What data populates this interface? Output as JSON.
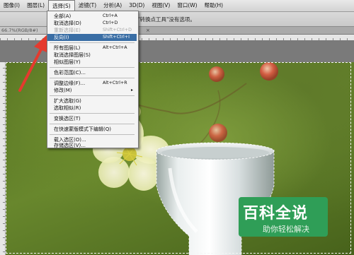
{
  "menubar": {
    "items": [
      {
        "label": "图像(I)"
      },
      {
        "label": "图层(L)"
      },
      {
        "label": "选择(S)"
      },
      {
        "label": "滤镜(T)"
      },
      {
        "label": "分析(A)"
      },
      {
        "label": "3D(D)"
      },
      {
        "label": "视图(V)"
      },
      {
        "label": "窗口(W)"
      },
      {
        "label": "帮助(H)"
      }
    ]
  },
  "options": {
    "hint": "\"转换点工具\"没有选项。"
  },
  "document": {
    "tab_label": "66.7%(RGB/8#)",
    "close_label": "×"
  },
  "select_menu": {
    "items": [
      {
        "label": "全部(A)",
        "shortcut": "Ctrl+A"
      },
      {
        "label": "取消选择(D)",
        "shortcut": "Ctrl+D"
      },
      {
        "label": "重新选择(E)",
        "shortcut": "Shift+Ctrl+D"
      },
      {
        "label": "反向(I)",
        "shortcut": "Shift+Ctrl+I"
      },
      {
        "label": "所有图层(L)",
        "shortcut": "Alt+Ctrl+A"
      },
      {
        "label": "取消选择图层(S)",
        "shortcut": ""
      },
      {
        "label": "相似图层(Y)",
        "shortcut": ""
      },
      {
        "label": "色彩范围(C)...",
        "shortcut": ""
      },
      {
        "label": "调整边缘(F)...",
        "shortcut": "Alt+Ctrl+R"
      },
      {
        "label": "修改(M)",
        "shortcut": ""
      },
      {
        "label": "扩大选取(G)",
        "shortcut": ""
      },
      {
        "label": "选取相似(R)",
        "shortcut": ""
      },
      {
        "label": "变换选区(T)",
        "shortcut": ""
      },
      {
        "label": "在快速蒙版模式下编辑(Q)",
        "shortcut": ""
      },
      {
        "label": "载入选区(O)...",
        "shortcut": ""
      },
      {
        "label": "存储选区(V)...",
        "shortcut": ""
      }
    ],
    "submenu_arrow": "▸"
  },
  "watermark": {
    "title": "百科全说",
    "subtitle": "助你轻松解决"
  },
  "colors": {
    "highlight": "#3a6ea5",
    "arrow": "#e53a2e",
    "watermark": "#2f9e57"
  }
}
